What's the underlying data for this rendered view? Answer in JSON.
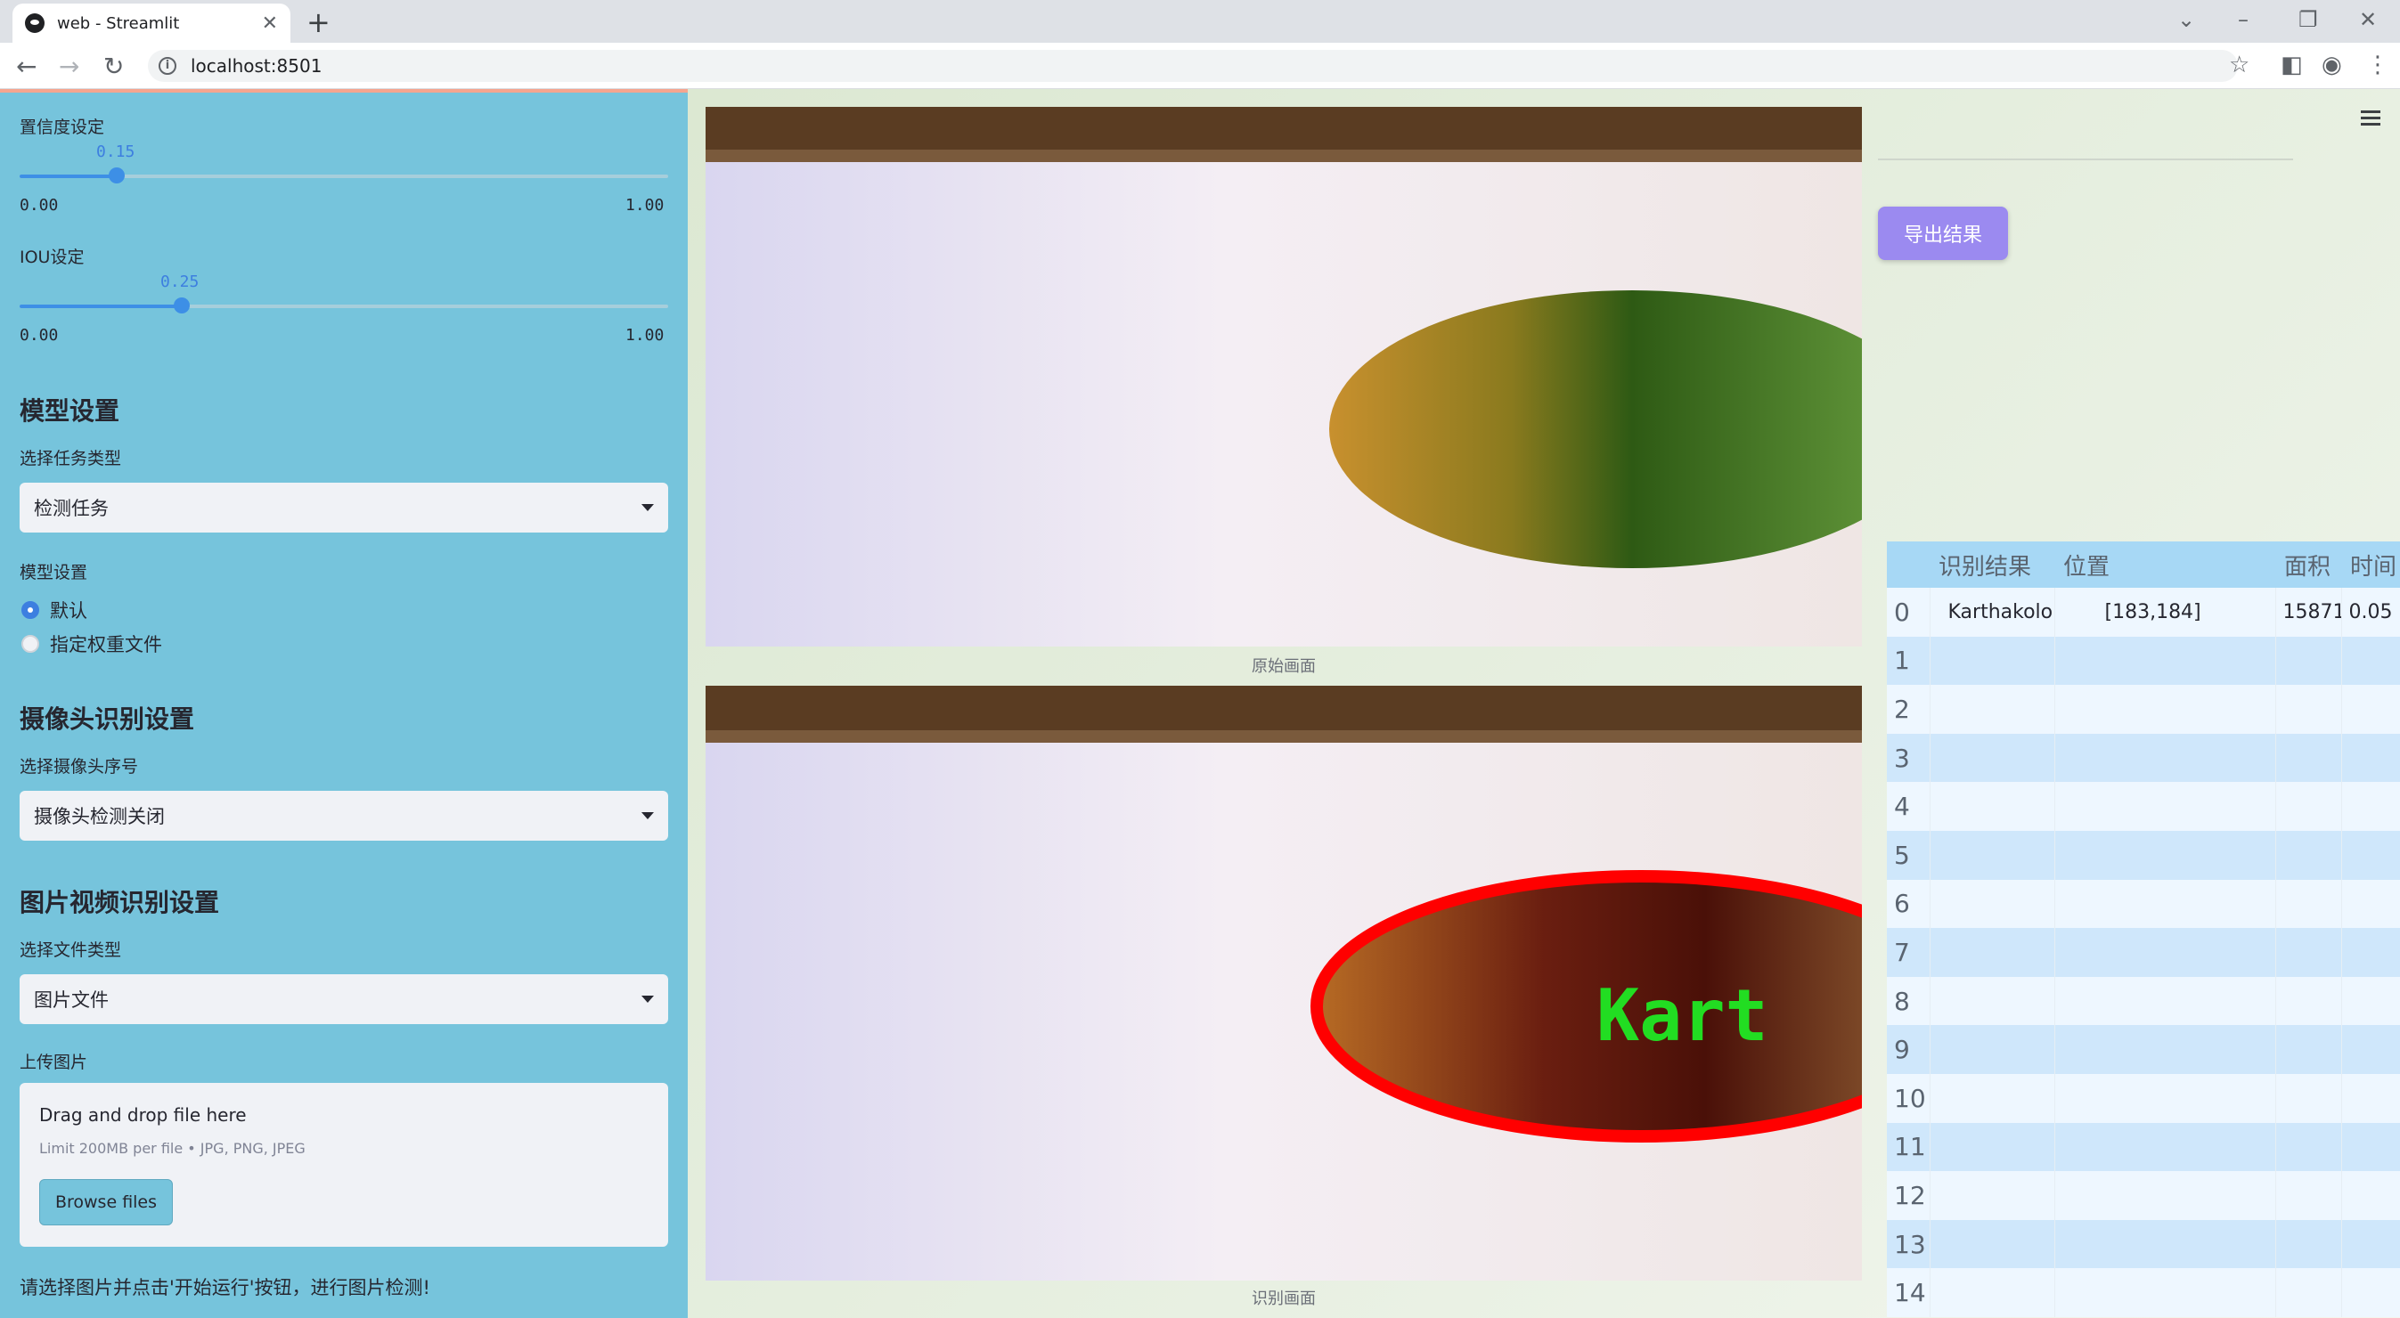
{
  "browser": {
    "tab_title": "web - Streamlit",
    "url": "localhost:8501"
  },
  "sidebar": {
    "confidence": {
      "label": "置信度设定",
      "value": "0.15",
      "value_num": 0.15,
      "min": "0.00",
      "max": "1.00"
    },
    "iou": {
      "label": "IOU设定",
      "value": "0.25",
      "value_num": 0.25,
      "min": "0.00",
      "max": "1.00"
    },
    "model_section": {
      "header": "模型设置",
      "task_label": "选择任务类型",
      "task_value": "检测任务",
      "weights_label": "模型设置",
      "option_default": "默认",
      "option_custom": "指定权重文件"
    },
    "camera_section": {
      "header": "摄像头识别设置",
      "camera_label": "选择摄像头序号",
      "camera_value": "摄像头检测关闭"
    },
    "media_section": {
      "header": "图片视频识别设置",
      "file_type_label": "选择文件类型",
      "file_type_value": "图片文件",
      "upload_label": "上传图片",
      "drop_text": "Drag and drop file here",
      "limit_text": "Limit 200MB per file • JPG, PNG, JPEG",
      "browse_label": "Browse files"
    },
    "hint": "请选择图片并点击'开始运行'按钮，进行图片检测!"
  },
  "main": {
    "original_caption": "原始画面",
    "result_caption": "识别画面",
    "detection_label": "Kart",
    "export_label": "导出结果"
  },
  "table": {
    "headers": [
      "",
      "识别结果",
      "位置",
      "面积",
      "时间"
    ],
    "row0": {
      "index": "0",
      "result": "Karthakolomban",
      "position": "[183,184]",
      "area": "15871",
      "time": "0.05"
    },
    "indices": [
      "1",
      "2",
      "3",
      "4",
      "5",
      "6",
      "7",
      "8",
      "9",
      "10",
      "11",
      "12",
      "13",
      "14"
    ]
  },
  "colors": {
    "sidebar_bg": "#76c4dc",
    "accent": "#3d8fe6",
    "export_button": "#9b8af0",
    "table_header": "#a7d8f5",
    "detection_box": "#ff0000",
    "detection_text": "#22dd22"
  }
}
